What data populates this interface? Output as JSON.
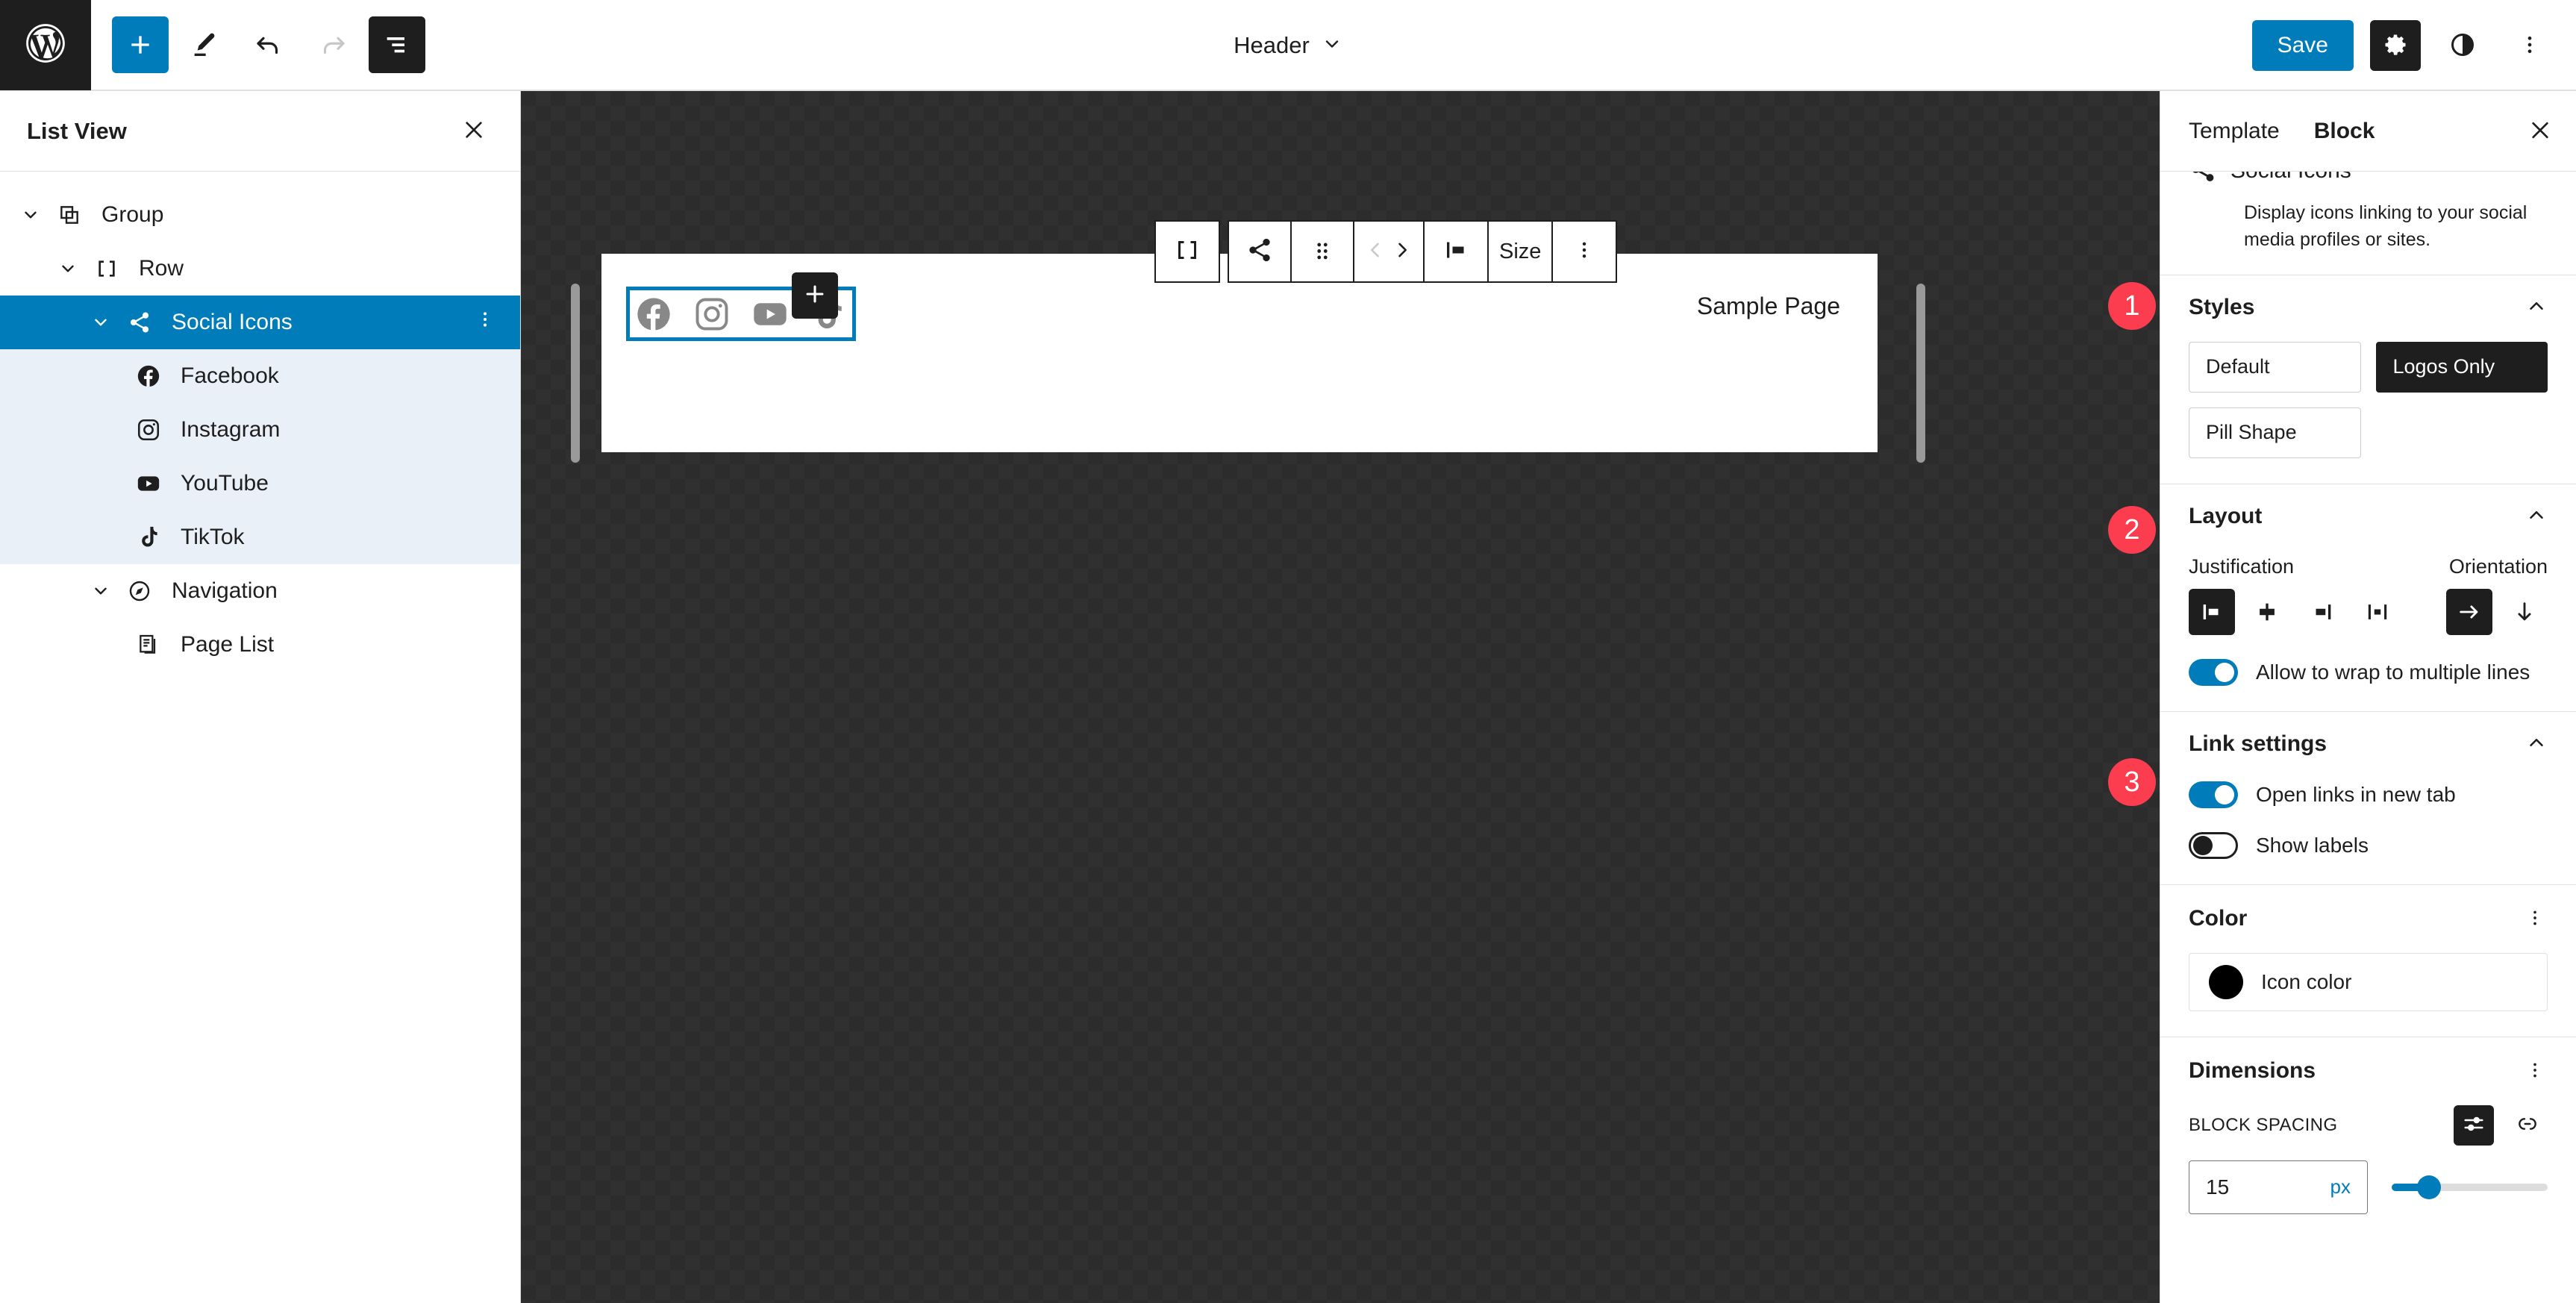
{
  "topbar": {
    "logo_icon": "wordpress-logo-icon",
    "add_block_label": "+",
    "tools": [
      {
        "name": "add-block-button",
        "icon": "plus-icon"
      },
      {
        "name": "edit-tool-button",
        "icon": "pencil-icon"
      },
      {
        "name": "undo-button",
        "icon": "undo-arrow-icon"
      },
      {
        "name": "redo-button",
        "icon": "redo-arrow-icon"
      },
      {
        "name": "list-view-button",
        "icon": "list-view-icon"
      }
    ],
    "document_title": "Header",
    "document_title_chevron": "chevron-down-icon",
    "save_label": "Save",
    "settings_icon": "gear-icon",
    "styles_icon": "contrast-half-circle-icon",
    "options_icon": "vertical-ellipsis-icon"
  },
  "list_view": {
    "title": "List View",
    "close_icon": "close-x-icon",
    "items": [
      {
        "label": "Group",
        "icon": "group-block-icon",
        "depth": 0,
        "expanded": true,
        "state": "normal"
      },
      {
        "label": "Row",
        "icon": "row-block-icon",
        "depth": 1,
        "expanded": true,
        "state": "normal"
      },
      {
        "label": "Social Icons",
        "icon": "share-social-icon",
        "depth": 2,
        "expanded": true,
        "state": "selected"
      },
      {
        "label": "Facebook",
        "icon": "facebook-icon",
        "depth": 3,
        "expanded": false,
        "state": "child-highlight"
      },
      {
        "label": "Instagram",
        "icon": "instagram-icon",
        "depth": 3,
        "expanded": false,
        "state": "child-highlight"
      },
      {
        "label": "YouTube",
        "icon": "youtube-icon",
        "depth": 3,
        "expanded": false,
        "state": "child-highlight"
      },
      {
        "label": "TikTok",
        "icon": "tiktok-icon",
        "depth": 3,
        "expanded": false,
        "state": "child-highlight"
      },
      {
        "label": "Navigation",
        "icon": "navigation-compass-icon",
        "depth": 1,
        "expanded": true,
        "state": "normal"
      },
      {
        "label": "Page List",
        "icon": "page-list-icon",
        "depth": 2,
        "expanded": false,
        "state": "normal"
      }
    ],
    "row_options_icon": "vertical-ellipsis-icon"
  },
  "block_toolbar": {
    "parent_icon": "row-block-icon",
    "block_type_icon": "share-social-icon",
    "drag_icon": "drag-handle-dots-icon",
    "move_prev_icon": "chevron-left-icon",
    "move_next_icon": "chevron-right-icon",
    "align_icon": "align-left-icon",
    "size_label": "Size",
    "more_icon": "vertical-ellipsis-icon"
  },
  "canvas": {
    "social_icons": [
      {
        "name": "facebook-icon",
        "label": "Facebook"
      },
      {
        "name": "instagram-icon",
        "label": "Instagram"
      },
      {
        "name": "youtube-icon",
        "label": "YouTube"
      },
      {
        "name": "tiktok-icon",
        "label": "TikTok"
      }
    ],
    "add_icon": "plus-icon",
    "nav_item": "Sample Page",
    "left_resize_handle": "canvas-resize-handle-left",
    "right_resize_handle": "canvas-resize-handle-right"
  },
  "inspector": {
    "tabs": [
      {
        "label": "Template",
        "active": false
      },
      {
        "label": "Block",
        "active": true
      }
    ],
    "close_icon": "close-x-icon",
    "block": {
      "name": "Social Icons",
      "icon": "share-social-icon",
      "description": "Display icons linking to your social media profiles or sites."
    },
    "styles": {
      "title": "Styles",
      "collapse_icon": "chevron-up-icon",
      "options": [
        {
          "label": "Default",
          "active": false
        },
        {
          "label": "Logos Only",
          "active": true
        },
        {
          "label": "Pill Shape",
          "active": false
        }
      ]
    },
    "layout": {
      "title": "Layout",
      "collapse_icon": "chevron-up-icon",
      "justification_label": "Justification",
      "orientation_label": "Orientation",
      "justification_options": [
        {
          "name": "justify-left",
          "active": true
        },
        {
          "name": "justify-center",
          "active": false
        },
        {
          "name": "justify-right",
          "active": false
        },
        {
          "name": "justify-space-between",
          "active": false
        }
      ],
      "orientation_options": [
        {
          "name": "orientation-horizontal",
          "active": true
        },
        {
          "name": "orientation-vertical",
          "active": false
        }
      ],
      "wrap_toggle_label": "Allow to wrap to multiple lines",
      "wrap_toggle_on": true
    },
    "link_settings": {
      "title": "Link settings",
      "collapse_icon": "chevron-up-icon",
      "open_new_tab_label": "Open links in new tab",
      "open_new_tab_on": true,
      "show_labels_label": "Show labels",
      "show_labels_on": false
    },
    "color": {
      "title": "Color",
      "options_icon": "vertical-ellipsis-icon",
      "icon_color_label": "Icon color",
      "icon_color_value": "#000000"
    },
    "dimensions": {
      "title": "Dimensions",
      "options_icon": "vertical-ellipsis-icon",
      "block_spacing_label": "BLOCK SPACING",
      "sliders_icon": "sliders-icon",
      "link_icon": "unlink-icon",
      "value": "15",
      "unit": "px"
    }
  },
  "annotations": [
    {
      "number": "1",
      "target": "Styles"
    },
    {
      "number": "2",
      "target": "Layout"
    },
    {
      "number": "3",
      "target": "Link settings"
    }
  ],
  "colors": {
    "accent": "#007cba",
    "dark": "#1e1e1e",
    "badge_red": "#fc3d50",
    "child_highlight": "#e9f0f7",
    "canvas_bg": "#2c2c2c"
  }
}
